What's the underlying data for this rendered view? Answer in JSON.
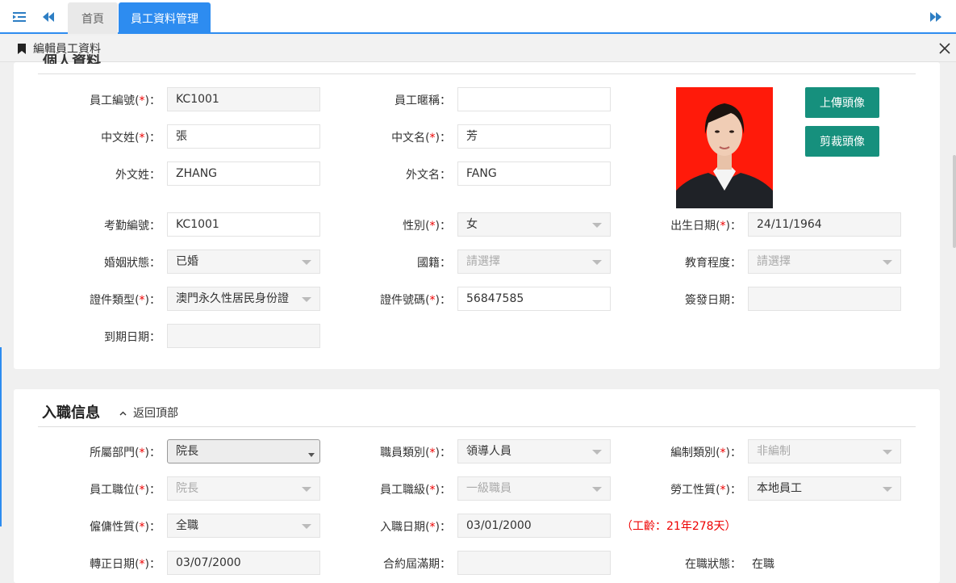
{
  "tabs": {
    "home": "首頁",
    "active": "員工資料管理"
  },
  "panel": {
    "title": "編輯員工資料"
  },
  "personal": {
    "heading": "個人資料",
    "upload_button": "上傳頭像",
    "crop_button": "剪裁頭像",
    "fields": [
      {
        "label": "員工編號",
        "required": true,
        "value": "KC1001",
        "kind": "readonly"
      },
      {
        "label": "員工暱稱",
        "required": false,
        "value": "",
        "kind": "input"
      },
      {
        "label": "中文姓",
        "required": true,
        "value": "張",
        "kind": "input"
      },
      {
        "label": "中文名",
        "required": true,
        "value": "芳",
        "kind": "input"
      },
      {
        "label": "外文姓",
        "required": false,
        "value": "ZHANG",
        "kind": "input"
      },
      {
        "label": "外文名",
        "required": false,
        "value": "FANG",
        "kind": "input"
      },
      {
        "label": "考勤編號",
        "required": false,
        "value": "KC1001",
        "kind": "input"
      },
      {
        "label": "性別",
        "required": true,
        "value": "女",
        "kind": "select"
      },
      {
        "label": "出生日期",
        "required": true,
        "value": "24/11/1964",
        "kind": "readonly"
      },
      {
        "label": "婚姻狀態",
        "required": false,
        "value": "已婚",
        "kind": "select"
      },
      {
        "label": "國籍",
        "required": false,
        "value": "請選擇",
        "kind": "select-placeholder"
      },
      {
        "label": "教育程度",
        "required": false,
        "value": "請選擇",
        "kind": "select-placeholder"
      },
      {
        "label": "證件類型",
        "required": true,
        "value": "澳門永久性居民身份證",
        "kind": "select"
      },
      {
        "label": "證件號碼",
        "required": true,
        "value": "56847585",
        "kind": "input"
      },
      {
        "label": "簽發日期",
        "required": false,
        "value": "",
        "kind": "readonly"
      },
      {
        "label": "到期日期",
        "required": false,
        "value": "",
        "kind": "readonly"
      }
    ]
  },
  "employment": {
    "title": "入職信息",
    "back_to_top": "返回頂部",
    "seniority": "（工齡：21年278天）",
    "fields": [
      {
        "label": "所屬部門",
        "required": true,
        "value": "院長",
        "kind": "dept"
      },
      {
        "label": "職員類別",
        "required": true,
        "value": "領導人員",
        "kind": "select"
      },
      {
        "label": "編制類別",
        "required": true,
        "value": "非編制",
        "kind": "select-placeholder"
      },
      {
        "label": "員工職位",
        "required": true,
        "value": "院長",
        "kind": "select-placeholder"
      },
      {
        "label": "員工職級",
        "required": true,
        "value": "一級職員",
        "kind": "select-placeholder"
      },
      {
        "label": "勞工性質",
        "required": true,
        "value": "本地員工",
        "kind": "select"
      },
      {
        "label": "僱傭性質",
        "required": true,
        "value": "全職",
        "kind": "select"
      },
      {
        "label": "入職日期",
        "required": true,
        "value": "03/01/2000",
        "kind": "readonly"
      },
      {
        "label": "轉正日期",
        "required": true,
        "value": "03/07/2000",
        "kind": "readonly"
      },
      {
        "label": "合約屆滿期",
        "required": false,
        "value": "",
        "kind": "readonly"
      },
      {
        "label": "在職狀態",
        "required": false,
        "value": "在職",
        "kind": "text"
      }
    ]
  },
  "colors": {
    "accent": "#2d8cf0",
    "button": "#16907d",
    "required": "#ee0000",
    "photo_bg": "#ff1a0a"
  },
  "icons": {
    "menu": "menu-indent-icon",
    "prev": "double-chevron-left-icon",
    "next": "double-chevron-right-icon",
    "bookmark": "bookmark-icon",
    "close": "close-icon"
  }
}
